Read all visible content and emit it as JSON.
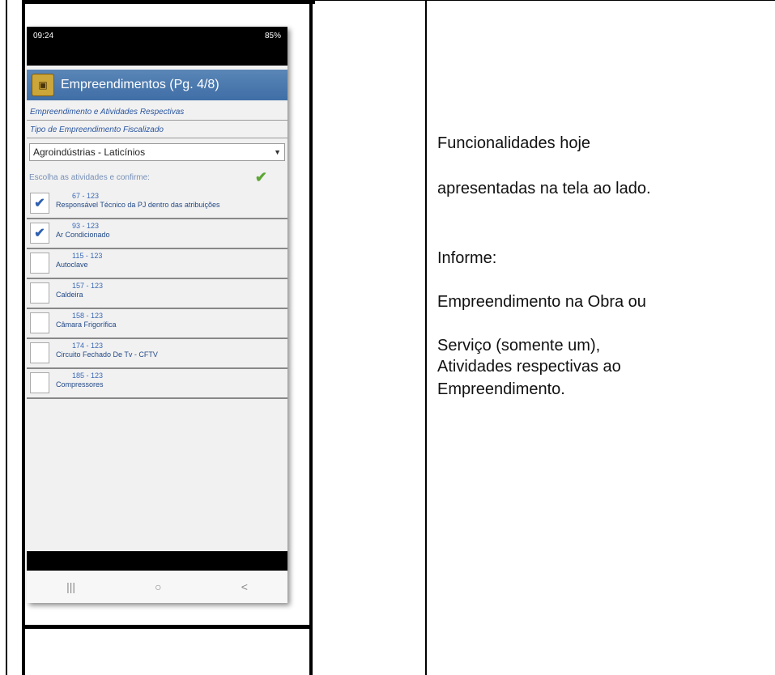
{
  "phone": {
    "status_time": "09:24",
    "status_right": "85%",
    "title": "Empreendimentos (Pg. 4/8)",
    "section_activities": "Empreendimento e Atividades Respectivas",
    "section_type": "Tipo de Empreendimento Fiscalizado",
    "dropdown_value": "Agroindústrias - Laticínios",
    "choose_label": "Escolha as atividades e confirme:",
    "items": [
      {
        "code": "67 - 123",
        "name": "Responsável Técnico da PJ dentro das atribuições",
        "checked": true
      },
      {
        "code": "93 - 123",
        "name": "Ar Condicionado",
        "checked": true
      },
      {
        "code": "115 - 123",
        "name": "Autoclave",
        "checked": false
      },
      {
        "code": "157 - 123",
        "name": "Caldeira",
        "checked": false
      },
      {
        "code": "158 - 123",
        "name": "Câmara Frigorífica",
        "checked": false
      },
      {
        "code": "174 - 123",
        "name": "Circuito Fechado De Tv - CFTV",
        "checked": false
      },
      {
        "code": "185 - 123",
        "name": "Compressores",
        "checked": false
      }
    ],
    "nav": {
      "recent": "|||",
      "home": "○",
      "back": "<"
    }
  },
  "right": {
    "line1": "Funcionalidades hoje",
    "line2": "apresentadas na tela ao lado.",
    "line3": "Informe:",
    "line4": "Empreendimento na Obra ou",
    "line5": "Serviço (somente um),",
    "line6": "Atividades respectivas ao",
    "line7": "Empreendimento."
  }
}
